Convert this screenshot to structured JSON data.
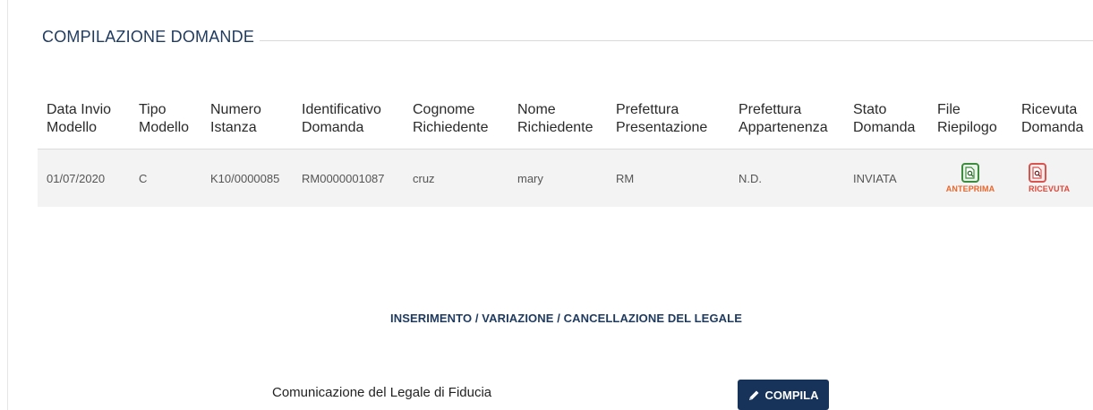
{
  "section": {
    "title": "COMPILAZIONE DOMANDE"
  },
  "table": {
    "headers": [
      [
        "Data Invio",
        "Modello"
      ],
      [
        "Tipo",
        "Modello"
      ],
      [
        "Numero",
        "Istanza"
      ],
      [
        "Identificativo",
        "Domanda"
      ],
      [
        "Cognome",
        "Richiedente"
      ],
      [
        "Nome",
        "Richiedente"
      ],
      [
        "Prefettura",
        "Presentazione"
      ],
      [
        "Prefettura",
        "Appartenenza"
      ],
      [
        "Stato",
        "Domanda"
      ],
      [
        "File",
        "Riepilogo"
      ],
      [
        "Ricevuta",
        "Domanda"
      ]
    ],
    "rows": [
      {
        "data_invio": "01/07/2020",
        "tipo": "C",
        "numero": "K10/0000085",
        "identificativo": "RM0000001087",
        "cognome": "cruz",
        "nome": "mary",
        "pref_presentazione": "RM",
        "pref_appartenenza": "N.D.",
        "stato": "INVIATA",
        "file_label": "ANTEPRIMA",
        "ricevuta_label": "RICEVUTA"
      }
    ]
  },
  "legale": {
    "heading": "INSERIMENTO / VARIAZIONE / CANCELLAZIONE DEL LEGALE",
    "label": "Comunicazione del Legale di Fiducia",
    "button": "COMPILA"
  },
  "colors": {
    "navy": "#17335a",
    "title": "#1f3a5f",
    "green": "#3d8b3d",
    "orange": "#e8672c",
    "red": "#d9534f"
  },
  "icons": {
    "file": "document-search-icon",
    "ricevuta": "document-search-icon",
    "compila": "pencil-icon"
  }
}
